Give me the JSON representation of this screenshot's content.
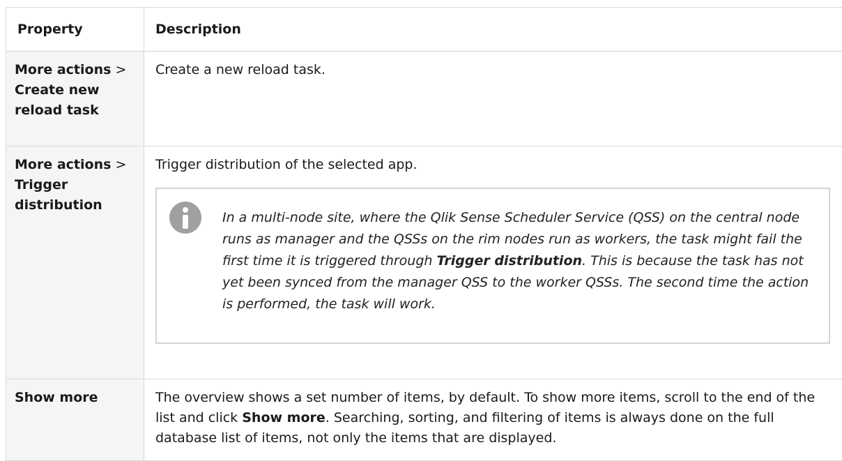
{
  "table": {
    "headers": {
      "property": "Property",
      "description": "Description"
    },
    "rows": [
      {
        "property_a": "More actions",
        "property_sep": " > ",
        "property_b": "Create new reload task",
        "description": "Create a new reload task."
      },
      {
        "property_a": "More actions",
        "property_sep": " > ",
        "property_b": "Trigger distribution",
        "description": "Trigger distribution of the selected app.",
        "note": {
          "icon": "info-icon",
          "text_before": "In a multi-node site, where the Qlik Sense Scheduler Service (QSS) on the central node runs as manager and the QSSs on the rim nodes run as workers, the task might fail the first time it is triggered through ",
          "emphasis": "Trigger distribution",
          "text_after": ". This is because the task has not yet been synced from the manager QSS to the worker QSSs. The second time the action is performed, the task will work."
        }
      },
      {
        "property": "Show more",
        "description_before": "The overview shows a set number of items, by default. To show more items, scroll to the end of the list and click ",
        "description_emphasis": "Show more",
        "description_after": ". Searching, sorting, and filtering of items is always done on the full database list of items, not only the items that are displayed."
      }
    ]
  }
}
